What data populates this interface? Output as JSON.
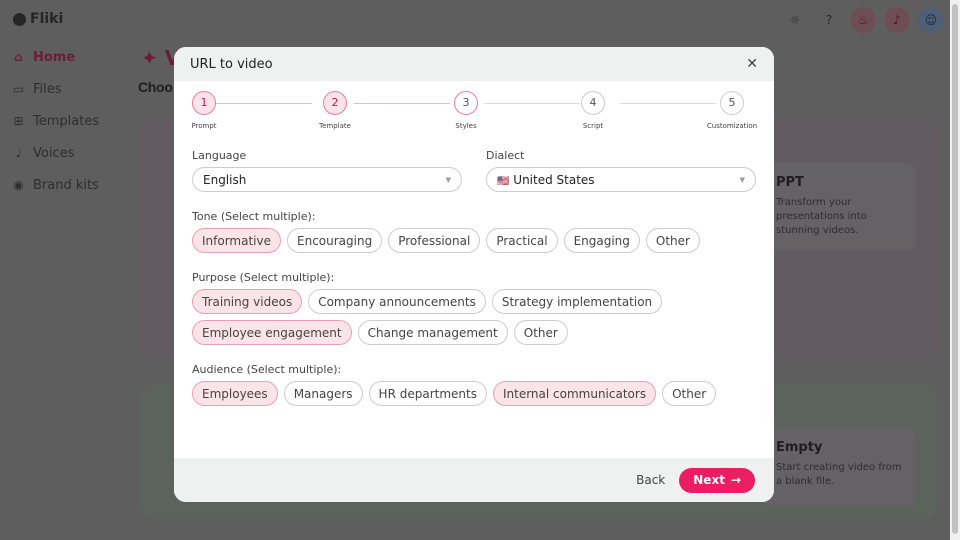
{
  "app": {
    "name": "Fliki"
  },
  "sidebar": {
    "items": [
      {
        "label": "Home",
        "icon": "home-icon",
        "active": true
      },
      {
        "label": "Files",
        "icon": "folder-icon"
      },
      {
        "label": "Templates",
        "icon": "templates-icon"
      },
      {
        "label": "Voices",
        "icon": "microphone-icon"
      },
      {
        "label": "Brand kits",
        "icon": "palette-icon"
      }
    ]
  },
  "topbar": {
    "icons": [
      "sun-icon",
      "help-icon",
      "fire-icon",
      "bell-icon",
      "user-icon"
    ]
  },
  "background": {
    "hero": "V",
    "choose": "Choo",
    "cards": [
      {
        "title": "PPT",
        "desc": "Transform your presentations into stunning videos."
      },
      {
        "title": "Empty",
        "desc": "Start creating video from a blank file."
      }
    ]
  },
  "modal": {
    "title": "URL to video",
    "steps": [
      {
        "num": "1",
        "label": "Prompt",
        "state": "done"
      },
      {
        "num": "2",
        "label": "Template",
        "state": "done"
      },
      {
        "num": "3",
        "label": "Styles",
        "state": "current"
      },
      {
        "num": "4",
        "label": "Script",
        "state": "todo"
      },
      {
        "num": "5",
        "label": "Customization",
        "state": "todo"
      }
    ],
    "language": {
      "label": "Language",
      "value": "English"
    },
    "dialect": {
      "label": "Dialect",
      "flag": "🇺🇸",
      "value": "United States"
    },
    "tone": {
      "label": "Tone (Select multiple):",
      "options": [
        {
          "label": "Informative",
          "selected": true
        },
        {
          "label": "Encouraging"
        },
        {
          "label": "Professional"
        },
        {
          "label": "Practical"
        },
        {
          "label": "Engaging"
        },
        {
          "label": "Other"
        }
      ]
    },
    "purpose": {
      "label": "Purpose (Select multiple):",
      "options": [
        {
          "label": "Training videos",
          "selected": true
        },
        {
          "label": "Company announcements"
        },
        {
          "label": "Strategy implementation"
        },
        {
          "label": "Employee engagement",
          "selected": true
        },
        {
          "label": "Change management"
        },
        {
          "label": "Other"
        }
      ]
    },
    "audience": {
      "label": "Audience (Select multiple):",
      "options": [
        {
          "label": "Employees",
          "selected": true
        },
        {
          "label": "Managers"
        },
        {
          "label": "HR departments"
        },
        {
          "label": "Internal communicators",
          "selected": true
        },
        {
          "label": "Other"
        }
      ]
    },
    "back": "Back",
    "next": "Next"
  },
  "colors": {
    "accent": "#e91e63",
    "selected_chip": "#fbe3ea"
  }
}
